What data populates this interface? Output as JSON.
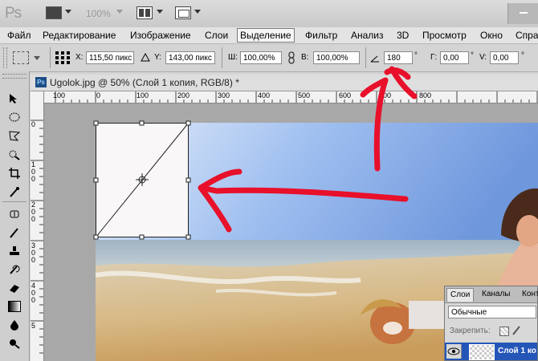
{
  "app": {
    "logo": "Ps",
    "zoom": "100%"
  },
  "menu": [
    {
      "label": "Файл"
    },
    {
      "label": "Редактирование"
    },
    {
      "label": "Изображение"
    },
    {
      "label": "Слои"
    },
    {
      "label": "Выделение"
    },
    {
      "label": "Фильтр"
    },
    {
      "label": "Анализ"
    },
    {
      "label": "3D"
    },
    {
      "label": "Просмотр"
    },
    {
      "label": "Окно"
    },
    {
      "label": "Справ"
    }
  ],
  "options": {
    "x_label": "X:",
    "x_value": "115,50 пикс",
    "y_label": "Y:",
    "y_value": "143,00 пикс",
    "w_label": "Ш:",
    "w_value": "100,00%",
    "h_label": "В:",
    "h_value": "100,00%",
    "angle_value": "180",
    "angle_unit": "°",
    "hskew_label": "Г:",
    "hskew_value": "0,00",
    "hskew_unit": "°",
    "vskew_label": "V:",
    "vskew_value": "0,00",
    "vskew_unit": "°"
  },
  "document": {
    "badge": "Ps",
    "title": "Ugolok.jpg @ 50% (Слой 1 копия, RGB/8) *"
  },
  "ruler_top": [
    "100",
    "0",
    "100",
    "200",
    "300",
    "400",
    "500",
    "600",
    "700",
    "800"
  ],
  "ruler_left": [
    "0",
    "1 0 0",
    "2 0 0",
    "3 0 0",
    "4 0 0",
    "5"
  ],
  "layers_panel": {
    "tabs": [
      "Слои",
      "Каналы",
      "Конт"
    ],
    "blend_mode": "Обычные",
    "lock_label": "Закрепить:",
    "layer_name": "Слой 1 ко"
  },
  "colors": {
    "annotation": "#e8102a",
    "selection_blue": "#2456b8",
    "accent": "#1c4e86"
  }
}
